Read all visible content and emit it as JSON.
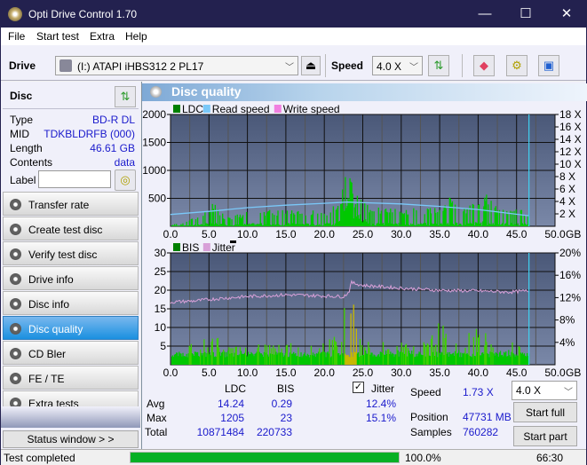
{
  "window": {
    "title": "Opti Drive Control 1.70",
    "minimize": "—",
    "maximize": "☐",
    "close": "✕"
  },
  "menu": [
    "File",
    "Start test",
    "Extra",
    "Help"
  ],
  "toolbar": {
    "drive_label": "Drive",
    "drive_value": "(I:)  ATAPI iHBS312   2 PL17",
    "speed_label": "Speed",
    "speed_value": "4.0 X",
    "icons": [
      "eject-icon",
      "refresh-icon",
      "erase-icon",
      "settings-icon",
      "save-icon"
    ]
  },
  "disc": {
    "header": "Disc",
    "rows": [
      {
        "k": "Type",
        "v": "BD-R DL"
      },
      {
        "k": "MID",
        "v": "TDKBLDRFB (000)"
      },
      {
        "k": "Length",
        "v": "46.61 GB"
      },
      {
        "k": "Contents",
        "v": "data"
      }
    ],
    "label_key": "Label",
    "label_value": ""
  },
  "nav": [
    {
      "label": "Transfer rate",
      "active": false
    },
    {
      "label": "Create test disc",
      "active": false
    },
    {
      "label": "Verify test disc",
      "active": false
    },
    {
      "label": "Drive info",
      "active": false
    },
    {
      "label": "Disc info",
      "active": false
    },
    {
      "label": "Disc quality",
      "active": true
    },
    {
      "label": "CD Bler",
      "active": false
    },
    {
      "label": "FE / TE",
      "active": false
    },
    {
      "label": "Extra tests",
      "active": false
    }
  ],
  "status_window": "Status window > >",
  "panel": {
    "title": "Disc quality"
  },
  "chart_data": [
    {
      "type": "bar",
      "title": "LDC",
      "legend": [
        "LDC",
        "Read speed",
        "Write speed"
      ],
      "legend_colors": [
        "#008000",
        "#7ac8f8",
        "#f080e0"
      ],
      "xlabel": "GB",
      "xlim": [
        0,
        50
      ],
      "ylim": [
        0,
        2000
      ],
      "y2lim": [
        0,
        18
      ],
      "x_ticks": [
        "0.0",
        "5.0",
        "10.0",
        "15.0",
        "20.0",
        "25.0",
        "30.0",
        "35.0",
        "40.0",
        "45.0",
        "50.0"
      ],
      "y_ticks": [
        "500",
        "1000",
        "1500",
        "2000"
      ],
      "y2_ticks": [
        "2 X",
        "4 X",
        "6 X",
        "8 X",
        "10 X",
        "12 X",
        "14 X",
        "16 X",
        "18 X"
      ],
      "end_marker_gb": 46.61,
      "ldc_envelope": [
        [
          0,
          30
        ],
        [
          2,
          80
        ],
        [
          4,
          250
        ],
        [
          5.5,
          420
        ],
        [
          7,
          200
        ],
        [
          9,
          220
        ],
        [
          11,
          330
        ],
        [
          13,
          300
        ],
        [
          15,
          330
        ],
        [
          17,
          300
        ],
        [
          19,
          280
        ],
        [
          21,
          350
        ],
        [
          22,
          500
        ],
        [
          23,
          1205
        ],
        [
          24,
          800
        ],
        [
          25,
          450
        ],
        [
          27,
          350
        ],
        [
          30,
          330
        ],
        [
          33,
          340
        ],
        [
          35,
          380
        ],
        [
          36.5,
          550
        ],
        [
          38,
          320
        ],
        [
          41,
          580
        ],
        [
          43,
          330
        ],
        [
          45,
          350
        ],
        [
          46.6,
          280
        ]
      ],
      "read_speed": [
        [
          0,
          1.9
        ],
        [
          5,
          2.4
        ],
        [
          10,
          3.0
        ],
        [
          15,
          3.4
        ],
        [
          20,
          3.7
        ],
        [
          23,
          3.9
        ],
        [
          25,
          3.8
        ],
        [
          30,
          3.6
        ],
        [
          35,
          3.2
        ],
        [
          40,
          2.7
        ],
        [
          46.6,
          1.7
        ]
      ]
    },
    {
      "type": "bar",
      "title": "BIS",
      "legend": [
        "BIS",
        "Jitter"
      ],
      "legend_colors": [
        "#008000",
        "#d8a0d8"
      ],
      "xlabel": "GB",
      "xlim": [
        0,
        50
      ],
      "ylim": [
        0,
        30
      ],
      "y2lim": [
        0,
        20
      ],
      "x_ticks": [
        "0.0",
        "5.0",
        "10.0",
        "15.0",
        "20.0",
        "25.0",
        "30.0",
        "35.0",
        "40.0",
        "45.0",
        "50.0"
      ],
      "y_ticks": [
        "5",
        "10",
        "15",
        "20",
        "25",
        "30"
      ],
      "y2_ticks": [
        "4%",
        "8%",
        "12%",
        "16%",
        "20%"
      ],
      "end_marker_gb": 46.61,
      "bis_envelope": [
        [
          0,
          3
        ],
        [
          3,
          6
        ],
        [
          5.5,
          9
        ],
        [
          7,
          5
        ],
        [
          10,
          5
        ],
        [
          13,
          6
        ],
        [
          15,
          6
        ],
        [
          18,
          5
        ],
        [
          20,
          6
        ],
        [
          22,
          9
        ],
        [
          23,
          23
        ],
        [
          23.5,
          18
        ],
        [
          25,
          7
        ],
        [
          28,
          6
        ],
        [
          30,
          7
        ],
        [
          33,
          6
        ],
        [
          35,
          12
        ],
        [
          37,
          6
        ],
        [
          40,
          11
        ],
        [
          42,
          7
        ],
        [
          45,
          6
        ],
        [
          46.6,
          5
        ]
      ],
      "jitter": [
        [
          0,
          11.2
        ],
        [
          3,
          11.4
        ],
        [
          6,
          11.8
        ],
        [
          10,
          12.2
        ],
        [
          15,
          12.5
        ],
        [
          20,
          12.3
        ],
        [
          22.5,
          12.2
        ],
        [
          23.2,
          13
        ],
        [
          23.5,
          14.7
        ],
        [
          25,
          14.2
        ],
        [
          30,
          13.7
        ],
        [
          35,
          13.3
        ],
        [
          40,
          13.2
        ],
        [
          44,
          13
        ],
        [
          46.6,
          13.2
        ]
      ]
    }
  ],
  "stats": {
    "col_ldc": "LDC",
    "col_bis": "BIS",
    "jitter_label": "Jitter",
    "jitter_checked": true,
    "rows": [
      {
        "k": "Avg",
        "ldc": "14.24",
        "bis": "0.29",
        "jit": "12.4%"
      },
      {
        "k": "Max",
        "ldc": "1205",
        "bis": "23",
        "jit": "15.1%"
      },
      {
        "k": "Total",
        "ldc": "10871484",
        "bis": "220733",
        "jit": ""
      }
    ],
    "speed_label": "Speed",
    "speed_value": "1.73 X",
    "position_label": "Position",
    "position_value": "47731 MB",
    "samples_label": "Samples",
    "samples_value": "760282",
    "speed_select": "4.0 X",
    "start_full": "Start full",
    "start_part": "Start part"
  },
  "statusbar": {
    "text": "Test completed",
    "progress_percent": 100,
    "progress_label": "100.0%",
    "time": "66:30"
  }
}
